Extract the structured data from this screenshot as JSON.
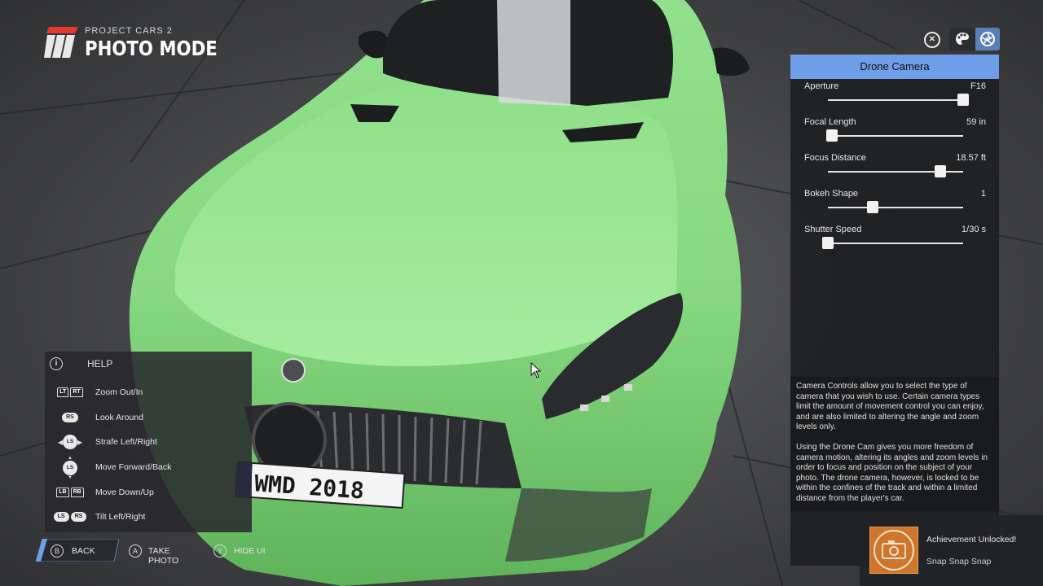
{
  "header": {
    "logo_small": "PROJECT CARS 2",
    "logo_big": "PHOTO MODE"
  },
  "top_icons": {
    "close_glyph": "⊗",
    "palette_icon": "palette-icon",
    "aperture_icon": "aperture-icon"
  },
  "drone_panel": {
    "title": "Drone Camera",
    "sliders": [
      {
        "label": "Aperture",
        "value": "F16",
        "level": 1.0
      },
      {
        "label": "Focal Length",
        "value": "59 in",
        "level": 0.03
      },
      {
        "label": "Focus Distance",
        "value": "18.57 ft",
        "level": 0.83
      },
      {
        "label": "Bokeh Shape",
        "value": "1",
        "level": 0.33
      },
      {
        "label": "Shutter Speed",
        "value": "1/30 s",
        "level": 0.0
      }
    ],
    "help_paragraphs": [
      "Camera Controls allow you to select the type of camera that you wish to use. Certain camera types limit the amount of movement control you can enjoy, and are also limited to altering the angle and zoom levels only.",
      "Using the Drone Cam gives you more freedom of camera motion, altering its angles and zoom levels in order to focus and position on the subject of your photo. The drone camera, however, is locked to be within the confines of the track and within a limited distance from the player's car."
    ],
    "accent_color": "#6f9ee9"
  },
  "help": {
    "info_glyph": "i",
    "title": "HELP",
    "rows": [
      {
        "label": "Zoom Out/In",
        "glyphs": [
          "LT",
          "RT"
        ]
      },
      {
        "label": "Look Around",
        "glyphs": [
          "RS"
        ]
      },
      {
        "label": "Strafe Left/Right",
        "glyphs": [
          "LS"
        ]
      },
      {
        "label": "Move Forward/Back",
        "glyphs": [
          "LS"
        ]
      },
      {
        "label": "Move Down/Up",
        "glyphs": [
          "LB",
          "RB"
        ]
      },
      {
        "label": "Tilt Left/Right",
        "glyphs": [
          "LS",
          "RS"
        ]
      }
    ]
  },
  "bottom_bar": {
    "back": {
      "key": "B",
      "label": "BACK"
    },
    "take_photo": {
      "key": "A",
      "label": "TAKE PHOTO"
    },
    "hide_ui": {
      "key": "Y",
      "label": "HIDE UI"
    }
  },
  "achievement": {
    "title": "Achievement Unlocked!",
    "name": "Snap Snap Snap",
    "icon": "camera-icon",
    "icon_color": "#d0762c"
  },
  "scene": {
    "car_color": "#7fd67a",
    "plate_text": "WMD 2018"
  }
}
